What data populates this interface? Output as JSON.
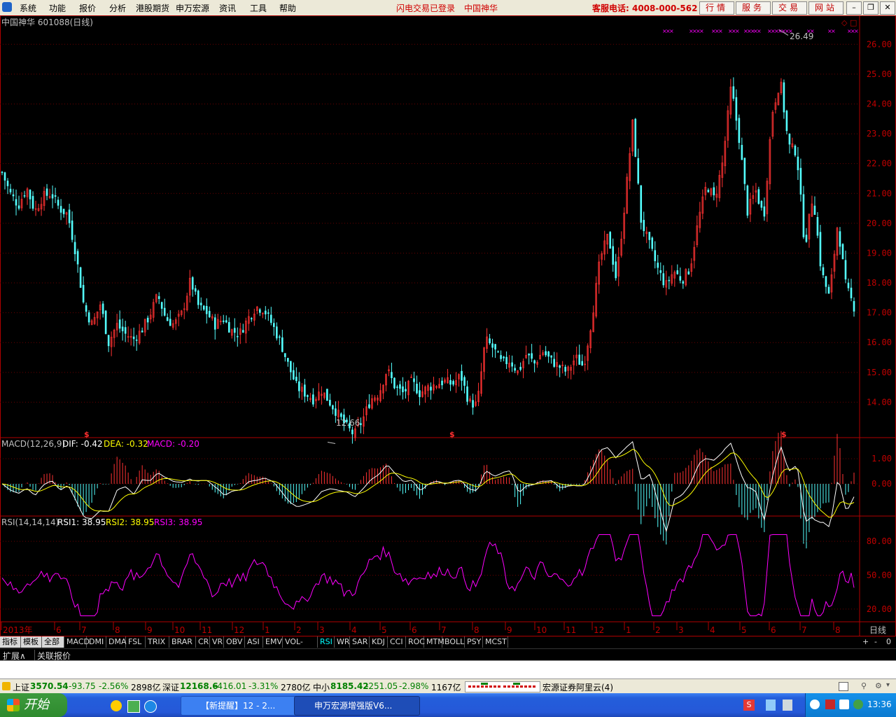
{
  "menu": {
    "items": [
      "系统",
      "功能",
      "报价",
      "分析",
      "港股期货",
      "申万宏源",
      "资讯",
      "工具",
      "帮助"
    ],
    "status_login": "闪电交易已登录",
    "status_stock": "中国神华",
    "hotline": "客服电话: 4008-000-562",
    "buttons": [
      "行情",
      "服务",
      "交易",
      "网站"
    ],
    "window_controls": [
      "minimize-icon",
      "restore-icon",
      "close-icon"
    ]
  },
  "chart_header": {
    "title": "中国神华 601088(日线)"
  },
  "macd_header": {
    "name": "MACD(12,26,9)",
    "dif": "DIF: -0.42",
    "dea": "DEA: -0.32",
    "macd": "MACD: -0.20"
  },
  "rsi_header": {
    "name": "RSI(14,14,14)",
    "rsi1": "RSI1: 38.95",
    "rsi2": "RSI2: 38.95",
    "rsi3": "RSI3: 38.95"
  },
  "annotations": {
    "high": "26.49",
    "low": "12.66",
    "marker": "$"
  },
  "right_label": "日线",
  "tabs": [
    "指标",
    "模板",
    "全部",
    "MACD",
    "DMI",
    "DMA",
    "FSL",
    "TRIX",
    "BRAR",
    "CR",
    "VR",
    "OBV",
    "ASI",
    "EMV",
    "VOL-TDX",
    "RSI",
    "WR",
    "SAR",
    "KDJ",
    "CCI",
    "ROC",
    "MTM",
    "BOLL",
    "PSY",
    "MCST"
  ],
  "active_tab": "RSI",
  "tab_right": [
    "+",
    "-",
    "0"
  ],
  "row2": [
    "扩展∧",
    "关联报价"
  ],
  "status": {
    "sh": {
      "label": "上证",
      "value": "3570.54",
      "chg": "-93.75",
      "pct": "-2.56%",
      "amt": "2898亿"
    },
    "sz": {
      "label": "深证",
      "value": "12168.6",
      "chg": "-416.01",
      "pct": "-3.31%",
      "amt": "2780亿"
    },
    "zx": {
      "label": "中小",
      "value": "8185.42",
      "chg": "-251.05",
      "pct": "-2.98%",
      "amt": "1167亿"
    },
    "broker": "宏源证券阿里云(4)"
  },
  "taskbar": {
    "start": "开始",
    "tasks": [
      "【新提醒】12 - 2...",
      "申万宏源增强版V6..."
    ],
    "clock": "13:36"
  },
  "chart_data": [
    {
      "type": "candlestick",
      "title": "中国神华 601088(日线)",
      "ylim": [
        13,
        26.5
      ],
      "y_ticks": [
        14.0,
        15.0,
        16.0,
        17.0,
        18.0,
        19.0,
        20.0,
        21.0,
        22.0,
        23.0,
        24.0,
        25.0,
        26.0
      ],
      "y_tick_labels": [
        "14.00",
        "15.00",
        "16.00",
        "17.00",
        "18.00",
        "19.00",
        "20.00",
        "21.00",
        "22.00",
        "23.00",
        "24.00",
        "25.00",
        "26.00"
      ],
      "x_tick_labels": [
        "2013年",
        "6",
        "7",
        "8",
        "9",
        "10",
        "11",
        "12",
        "1",
        "2",
        "3",
        "4",
        "5",
        "6",
        "7",
        "8",
        "9",
        "10",
        "11",
        "12",
        "1",
        "2",
        "3",
        "4",
        "5",
        "6",
        "7",
        "8"
      ],
      "close_path": [
        21.7,
        21.0,
        20.6,
        21.2,
        20.4,
        20.9,
        21.0,
        20.5,
        20.3,
        19.0,
        17.2,
        16.6,
        17.3,
        16.0,
        16.6,
        16.3,
        16.1,
        16.4,
        16.9,
        17.6,
        16.8,
        16.6,
        17.0,
        18.1,
        17.2,
        17.0,
        16.6,
        16.8,
        16.4,
        16.3,
        16.8,
        17.2,
        17.1,
        16.6,
        16.0,
        15.2,
        14.5,
        14.3,
        14.1,
        14.4,
        14.0,
        13.6,
        13.2,
        12.9,
        13.4,
        14.1,
        14.3,
        15.1,
        14.5,
        14.3,
        14.7,
        14.3,
        14.5,
        14.6,
        14.7,
        14.6,
        14.9,
        14.0,
        13.9,
        16.1,
        15.8,
        15.3,
        15.4,
        15.0,
        15.6,
        15.3,
        15.7,
        15.4,
        15.2,
        15.0,
        15.5,
        15.2,
        16.8,
        18.8,
        19.6,
        18.1,
        20.6,
        23.4,
        20.1,
        19.3,
        18.5,
        17.9,
        18.4,
        18.1,
        18.5,
        20.1,
        21.3,
        20.8,
        22.1,
        24.6,
        22.8,
        20.4,
        21.1,
        20.2,
        23.7,
        24.8,
        22.6,
        22.4,
        19.2,
        21.0,
        18.4,
        17.5,
        20.0,
        17.9,
        17.2
      ],
      "high": 26.49,
      "low": 12.66,
      "last_close": 17.2
    },
    {
      "type": "bar+line",
      "title": "MACD(12,26,9)",
      "ylim": [
        -1.2,
        1.2
      ],
      "y_ticks": [
        0.0,
        1.0
      ],
      "y_tick_labels": [
        "0.00",
        "1.00"
      ],
      "series": [
        {
          "name": "DIF",
          "last": -0.42
        },
        {
          "name": "DEA",
          "last": -0.32
        },
        {
          "name": "MACD",
          "last": -0.2
        }
      ]
    },
    {
      "type": "line",
      "title": "RSI(14,14,14)",
      "ylim": [
        10,
        90
      ],
      "y_ticks": [
        20.0,
        50.0,
        80.0
      ],
      "y_tick_labels": [
        "20.00",
        "50.00",
        "80.00"
      ],
      "series": [
        {
          "name": "RSI1",
          "last": 38.95
        },
        {
          "name": "RSI2",
          "last": 38.95
        },
        {
          "name": "RSI3",
          "last": 38.95
        }
      ]
    }
  ]
}
